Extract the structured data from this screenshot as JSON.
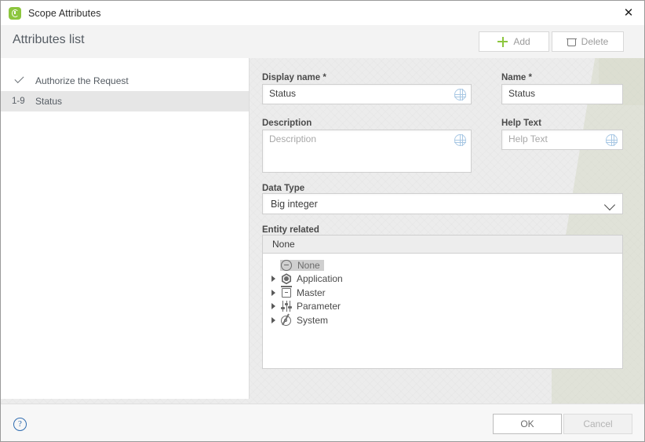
{
  "window": {
    "title": "Scope Attributes",
    "app_icon": "clock-green-icon",
    "close_label": "✕",
    "accent_green": "#8cc63e",
    "accent_blue": "#a9c8e4",
    "selection_gray": "#e6e6e6"
  },
  "toolbar": {
    "title": "Attributes list",
    "add_label": "Add",
    "delete_label": "Delete"
  },
  "attributes_list": [
    {
      "badge": "",
      "icon": "check-icon",
      "label": "Authorize the Request",
      "selected": false
    },
    {
      "badge": "1-9",
      "icon": "number-range-icon",
      "label": "Status",
      "selected": true
    }
  ],
  "form": {
    "display_name": {
      "label": "Display name *",
      "value": "Status",
      "placeholder": "Display name",
      "translate_icon": "globe-icon"
    },
    "name": {
      "label": "Name *",
      "value": "Status",
      "placeholder": "Name"
    },
    "description": {
      "label": "Description",
      "value": "",
      "placeholder": "Description",
      "translate_icon": "globe-icon"
    },
    "help_text": {
      "label": "Help Text",
      "value": "",
      "placeholder": "Help Text",
      "translate_icon": "globe-icon"
    },
    "data_type": {
      "label": "Data Type",
      "value": "Big integer"
    },
    "entity_related": {
      "label": "Entity related",
      "selected_value": "None",
      "tree": [
        {
          "label": "None",
          "icon": "circle-minus-icon",
          "expandable": false,
          "selected": true
        },
        {
          "label": "Application",
          "icon": "hexagon-icon",
          "expandable": true,
          "selected": false
        },
        {
          "label": "Master",
          "icon": "cabinet-icon",
          "expandable": true,
          "selected": false
        },
        {
          "label": "Parameter",
          "icon": "sliders-icon",
          "expandable": true,
          "selected": false
        },
        {
          "label": "System",
          "icon": "gear-icon",
          "expandable": true,
          "selected": false
        }
      ]
    }
  },
  "footer": {
    "help_icon": "question-mark-icon",
    "help_glyph": "?",
    "ok_label": "OK",
    "cancel_label": "Cancel"
  }
}
